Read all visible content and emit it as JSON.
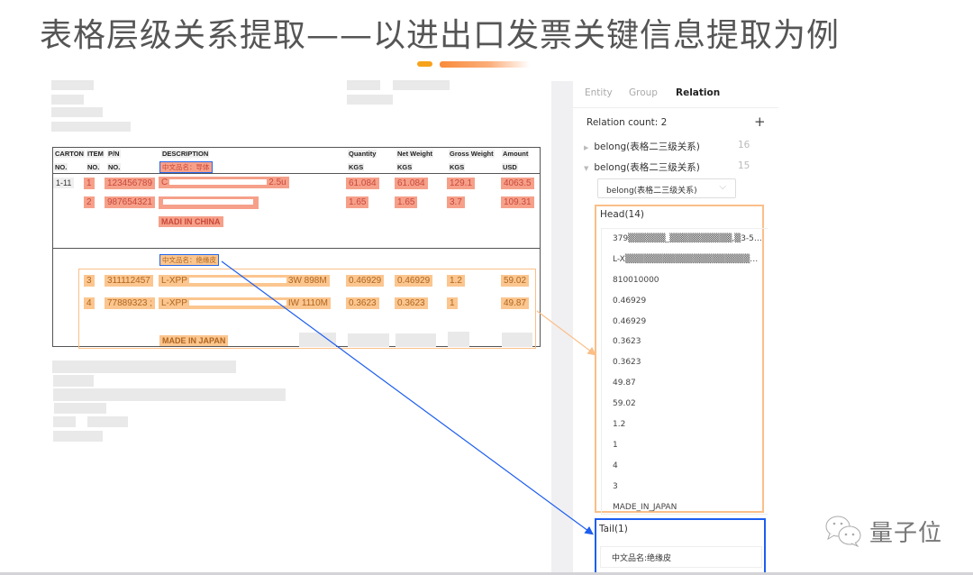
{
  "slide": {
    "title": "表格层级关系提取——以进出口发票关键信息提取为例"
  },
  "invoice": {
    "headers_row1": [
      "CARTON",
      "ITEM",
      "P/N",
      "DESCRIPTION",
      "Quantity",
      "Net Weight",
      "Gross Weight",
      "Amount"
    ],
    "headers_row2": [
      "NO.",
      "NO.",
      "NO.",
      "",
      "KGS",
      "KGS",
      "KGS",
      "USD"
    ],
    "group1": {
      "cn_name_tag": "中文品名：导体",
      "carton": "1-11",
      "rows": [
        {
          "item": "1",
          "pn": "123456789",
          "desc_prefix": "C",
          "desc_suffix": "2.5u",
          "quantity": "61.084",
          "net_weight": "61.084",
          "gross_weight": "129.1",
          "amount": "4063.5"
        },
        {
          "item": "2",
          "pn": "987654321",
          "desc_prefix": "",
          "desc_suffix": "",
          "quantity": "1.65",
          "net_weight": "1.65",
          "gross_weight": "3.7",
          "amount": "109.31"
        }
      ],
      "origin": "MADI IN CHINA"
    },
    "group2": {
      "cn_name_tag": "中文品名：绝缘皮",
      "rows": [
        {
          "item": "3",
          "pn": "311112457",
          "desc_prefix": "L-XPP",
          "desc_suffix": "3W  898M",
          "quantity": "0.46929",
          "net_weight": "0.46929",
          "gross_weight": "1.2",
          "amount": "59.02"
        },
        {
          "item": "4",
          "pn": "77889323 ;",
          "desc_prefix": "L-XPP",
          "desc_suffix": "IW 1110M",
          "quantity": "0.3623",
          "net_weight": "0.3623",
          "gross_weight": "1",
          "amount": "49.87"
        }
      ],
      "origin": "MADE IN JAPAN"
    }
  },
  "panel": {
    "tabs": [
      {
        "label": "Entity",
        "active": false
      },
      {
        "label": "Group",
        "active": false
      },
      {
        "label": "Relation",
        "active": true
      }
    ],
    "relation_count_label": "Relation count: 2",
    "add_icon": "plus-icon",
    "relations": [
      {
        "label": "belong(表格二三级关系)",
        "count": "16",
        "expanded": false
      },
      {
        "label": "belong(表格二三级关系)",
        "count": "15",
        "expanded": true
      }
    ],
    "relation_type_select": "belong(表格二三级关系)",
    "head": {
      "label": "Head(14)",
      "items": [
        "379▒▒▒▒▒▒_▒▒▒▒▒▒▒▒▒▒,▒3-50...",
        "L-X▒▒▒▒▒▒▒▒▒▒▒▒▒▒▒▒▒▒▒▒R_7...",
        "810010000",
        "0.46929",
        "0.46929",
        "0.3623",
        "0.3623",
        "49.87",
        "59.02",
        "1.2",
        "1",
        "4",
        "3",
        "MADE_IN_JAPAN"
      ]
    },
    "tail": {
      "label": "Tail(1)",
      "items": [
        "中文品名:绝缘皮"
      ]
    }
  },
  "watermark": {
    "icon": "wechat-icon",
    "text": "量子位"
  },
  "colors": {
    "head_highlight": "#fbbf88",
    "tail_highlight": "#1d5ef0",
    "group1_highlight": "#f6a08a",
    "title_accent": "#f7a21b"
  }
}
